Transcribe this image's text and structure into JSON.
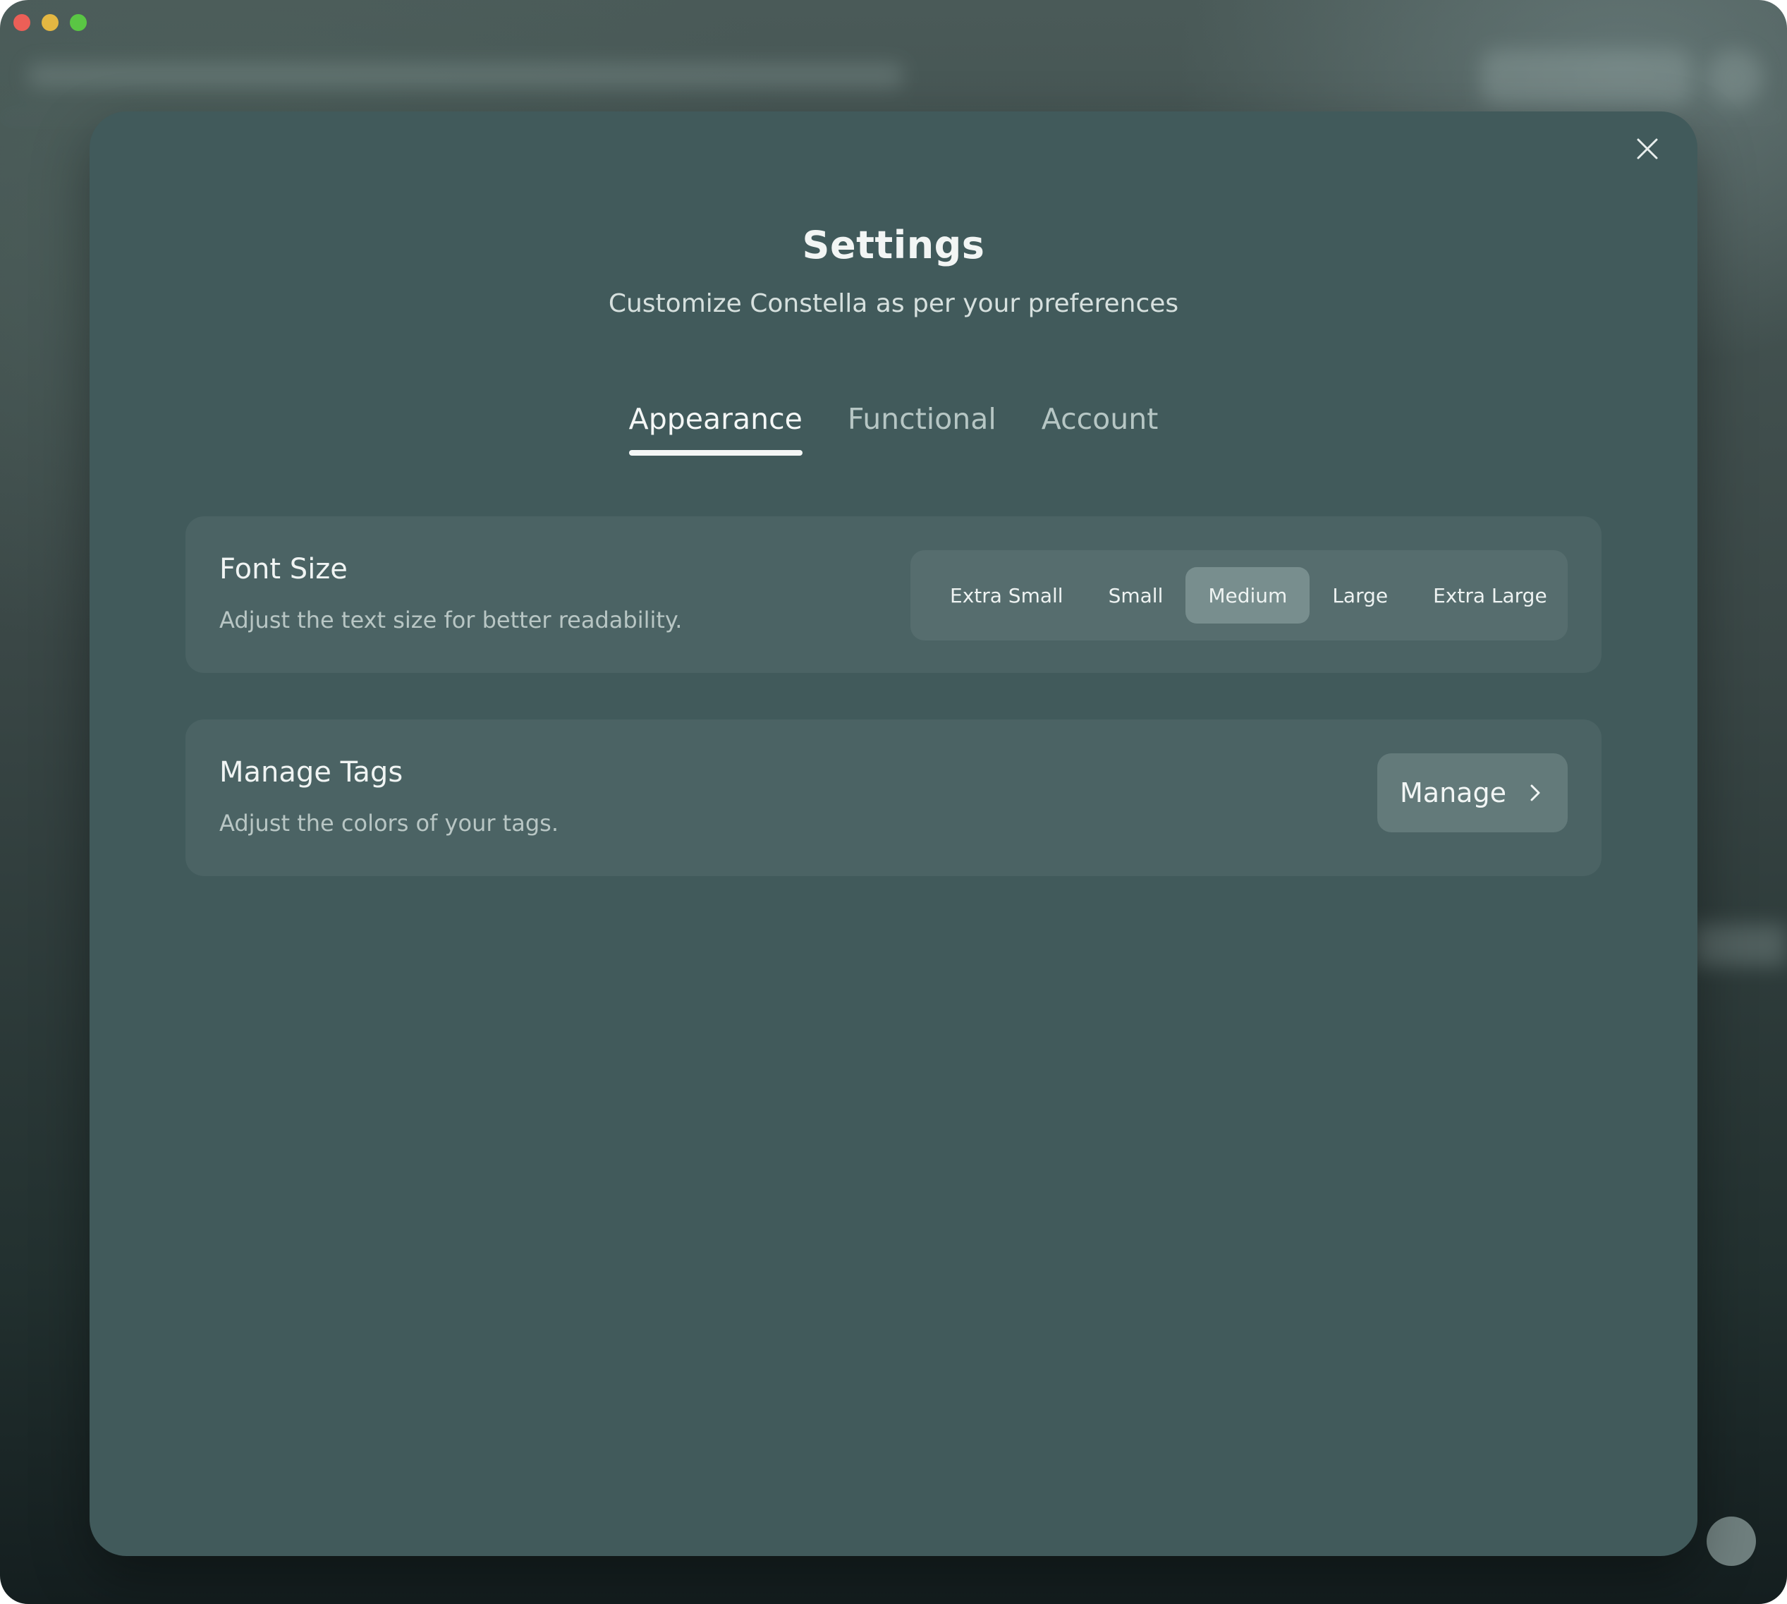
{
  "window": {
    "controls": [
      "close",
      "minimize",
      "zoom"
    ]
  },
  "modal": {
    "title": "Settings",
    "subtitle": "Customize Constella as per your preferences",
    "close_icon": "close-icon",
    "tabs": [
      {
        "label": "Appearance",
        "active": true
      },
      {
        "label": "Functional",
        "active": false
      },
      {
        "label": "Account",
        "active": false
      }
    ]
  },
  "font_size": {
    "title": "Font Size",
    "description": "Adjust the text size for better readability.",
    "options": [
      "Extra Small",
      "Small",
      "Medium",
      "Large",
      "Extra Large"
    ],
    "selected": "Medium"
  },
  "manage_tags": {
    "title": "Manage Tags",
    "description": "Adjust the colors of your tags.",
    "button_label": "Manage",
    "button_icon": "chevron-right-icon"
  },
  "colors": {
    "modal_bg": "#415a5b",
    "card_bg": "#4b6364",
    "selected_option_bg": "#788e8e",
    "text_primary": "#f2f5f4",
    "text_secondary": "#b8c6c4",
    "traffic_red": "#ec5f57",
    "traffic_yellow": "#e4b742",
    "traffic_green": "#5ac644"
  }
}
